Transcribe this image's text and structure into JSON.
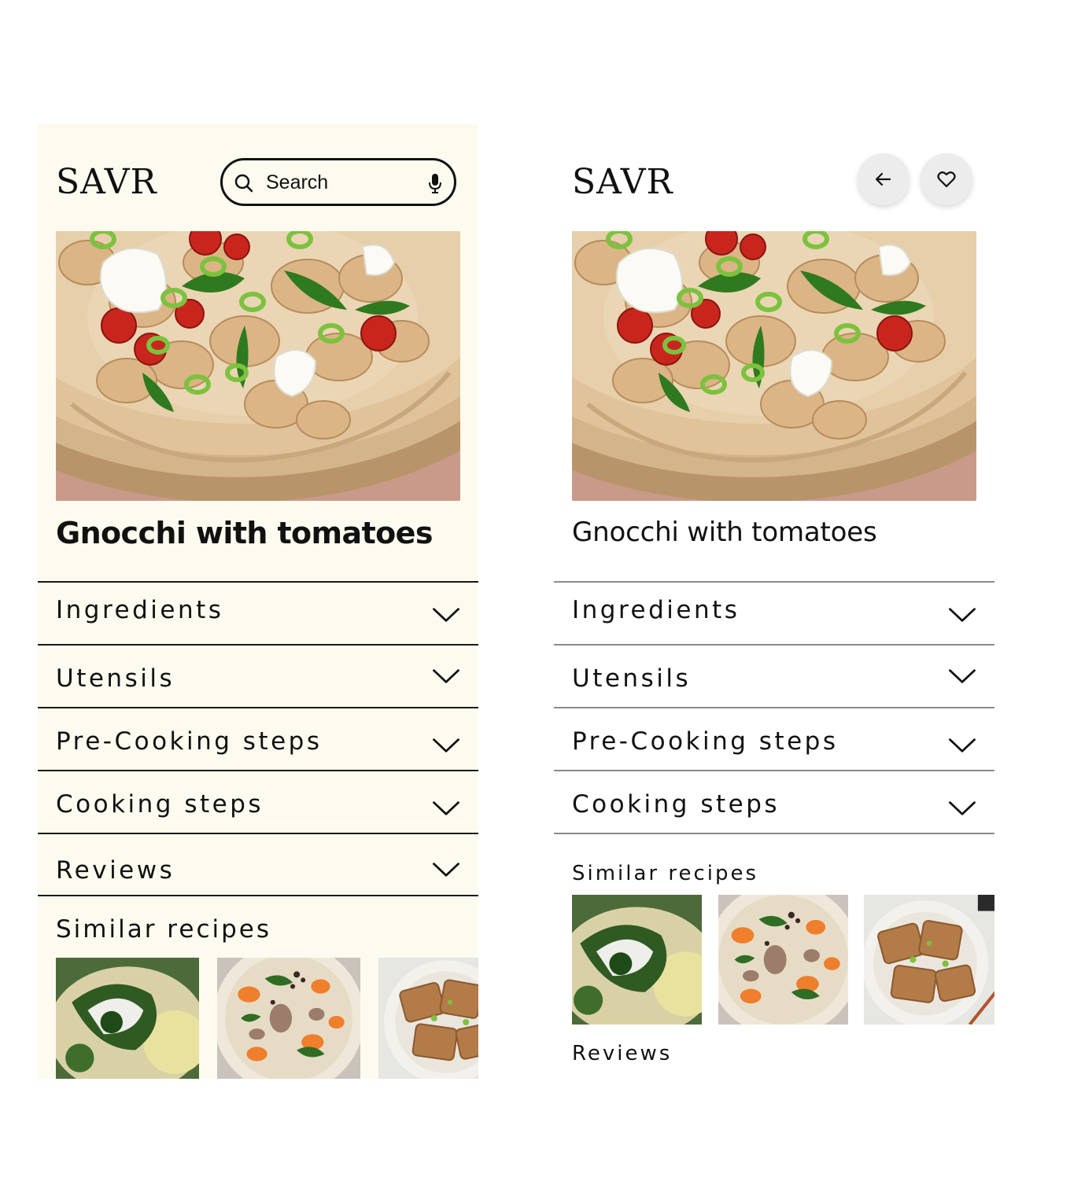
{
  "screen_a": {
    "logo": "SAVR",
    "search": {
      "placeholder": "Search"
    },
    "title": "Gnocchi with tomatoes",
    "accordion": [
      {
        "label": "Ingredients"
      },
      {
        "label": "Utensils"
      },
      {
        "label": "Pre-Cooking steps"
      },
      {
        "label": "Cooking steps"
      },
      {
        "label": "Reviews"
      }
    ],
    "similar": {
      "heading": "Similar recipes"
    }
  },
  "screen_b": {
    "logo": "SAVR",
    "title": "Gnocchi with tomatoes",
    "accordion": [
      {
        "label": "Ingredients"
      },
      {
        "label": "Utensils"
      },
      {
        "label": "Pre-Cooking steps"
      },
      {
        "label": "Cooking steps"
      }
    ],
    "similar": {
      "heading": "Similar recipes"
    },
    "reviews_heading": "Reviews"
  },
  "icons": {
    "search": "magnifier-icon",
    "mic": "microphone-icon",
    "back": "arrow-left-icon",
    "favorite": "heart-icon",
    "expand": "chevron-down-icon"
  },
  "colors": {
    "cream_background": "#fdfbef",
    "text": "#111111",
    "divider_dark": "#1a1a1a",
    "divider_light": "#8a8a8a",
    "button_gray": "#ececec"
  }
}
